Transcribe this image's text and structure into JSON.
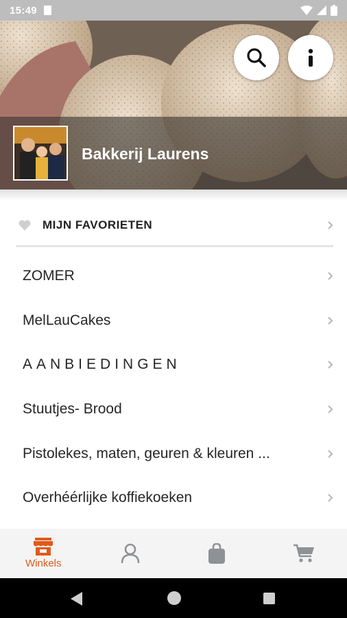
{
  "status_bar": {
    "time": "15:49"
  },
  "header": {
    "shop_name": "Bakkerij Laurens"
  },
  "favorites": {
    "label": "MIJN FAVORIETEN"
  },
  "categories": [
    {
      "label": "ZOMER"
    },
    {
      "label": "MelLauCakes"
    },
    {
      "label": "AANBIEDINGEN"
    },
    {
      "label": "Stuutjes- Brood"
    },
    {
      "label": "Pistolekes, maten, geuren & kleuren ..."
    },
    {
      "label": "Overhéérlijke koffiekoeken"
    }
  ],
  "bottom_nav": [
    {
      "label": "Winkels",
      "icon": "store-icon",
      "active": true
    },
    {
      "label": "",
      "icon": "user-icon",
      "active": false
    },
    {
      "label": "",
      "icon": "shopping-bag-icon",
      "active": false
    },
    {
      "label": "",
      "icon": "cart-icon",
      "active": false
    }
  ],
  "colors": {
    "accent": "#e05a1a",
    "inactive_icon": "#8e9196",
    "divider": "#e4e4e4"
  }
}
